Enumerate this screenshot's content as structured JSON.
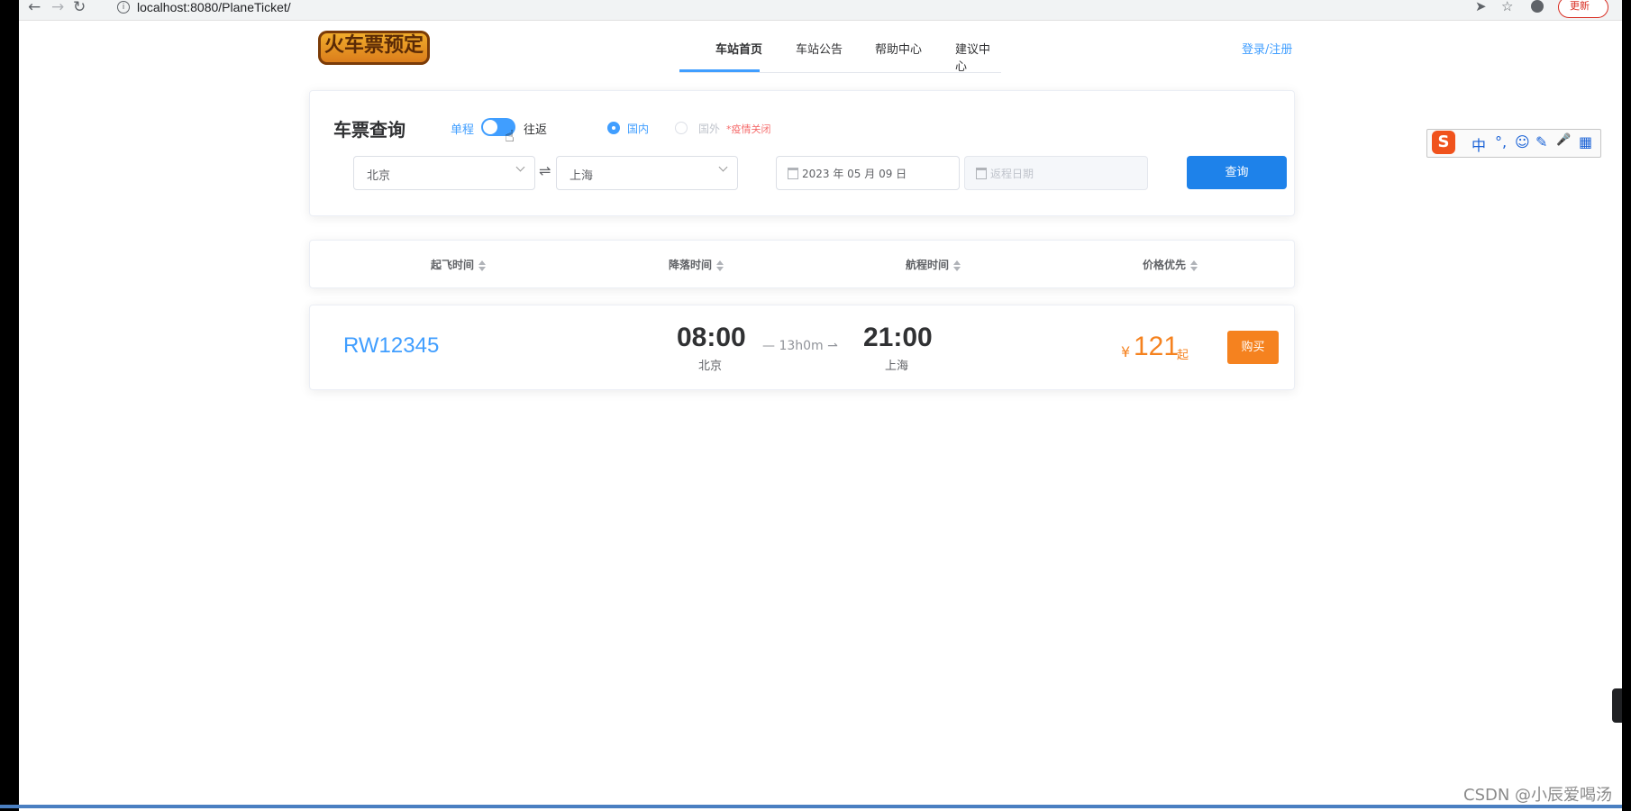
{
  "browser": {
    "url": "localhost:8080/PlaneTicket/",
    "update_label": "更新"
  },
  "header": {
    "logo_text": "火车票预定",
    "nav": [
      "车站首页",
      "车站公告",
      "帮助中心",
      "建议中心"
    ],
    "login_label": "登录/注册"
  },
  "search": {
    "title": "车票查询",
    "one_way_label": "单程",
    "round_trip_label": "往返",
    "domestic_label": "国内",
    "international_label": "国外",
    "closed_note": "*疫情关闭",
    "from_city": "北京",
    "to_city": "上海",
    "depart_date": "2023 年 05 月 09 日",
    "return_date_placeholder": "返程日期",
    "query_label": "查询"
  },
  "sort": {
    "items": [
      "起飞时间",
      "降落时间",
      "航程时间",
      "价格优先"
    ]
  },
  "results": [
    {
      "train_no": "RW12345",
      "depart_time": "08:00",
      "depart_city": "北京",
      "duration": "13h0m",
      "arrive_time": "21:00",
      "arrive_city": "上海",
      "currency": "¥",
      "price": "121",
      "price_suffix": "起",
      "buy_label": "购买"
    }
  ],
  "ime": {
    "items": [
      "中",
      "°,",
      "☺",
      "✎",
      "🎤",
      "▦"
    ]
  },
  "watermark": "CSDN @小辰爱喝汤",
  "colors": {
    "primary": "#409eff",
    "button": "#1e82ea",
    "price": "#f5821f",
    "warning": "#f56c6c"
  }
}
